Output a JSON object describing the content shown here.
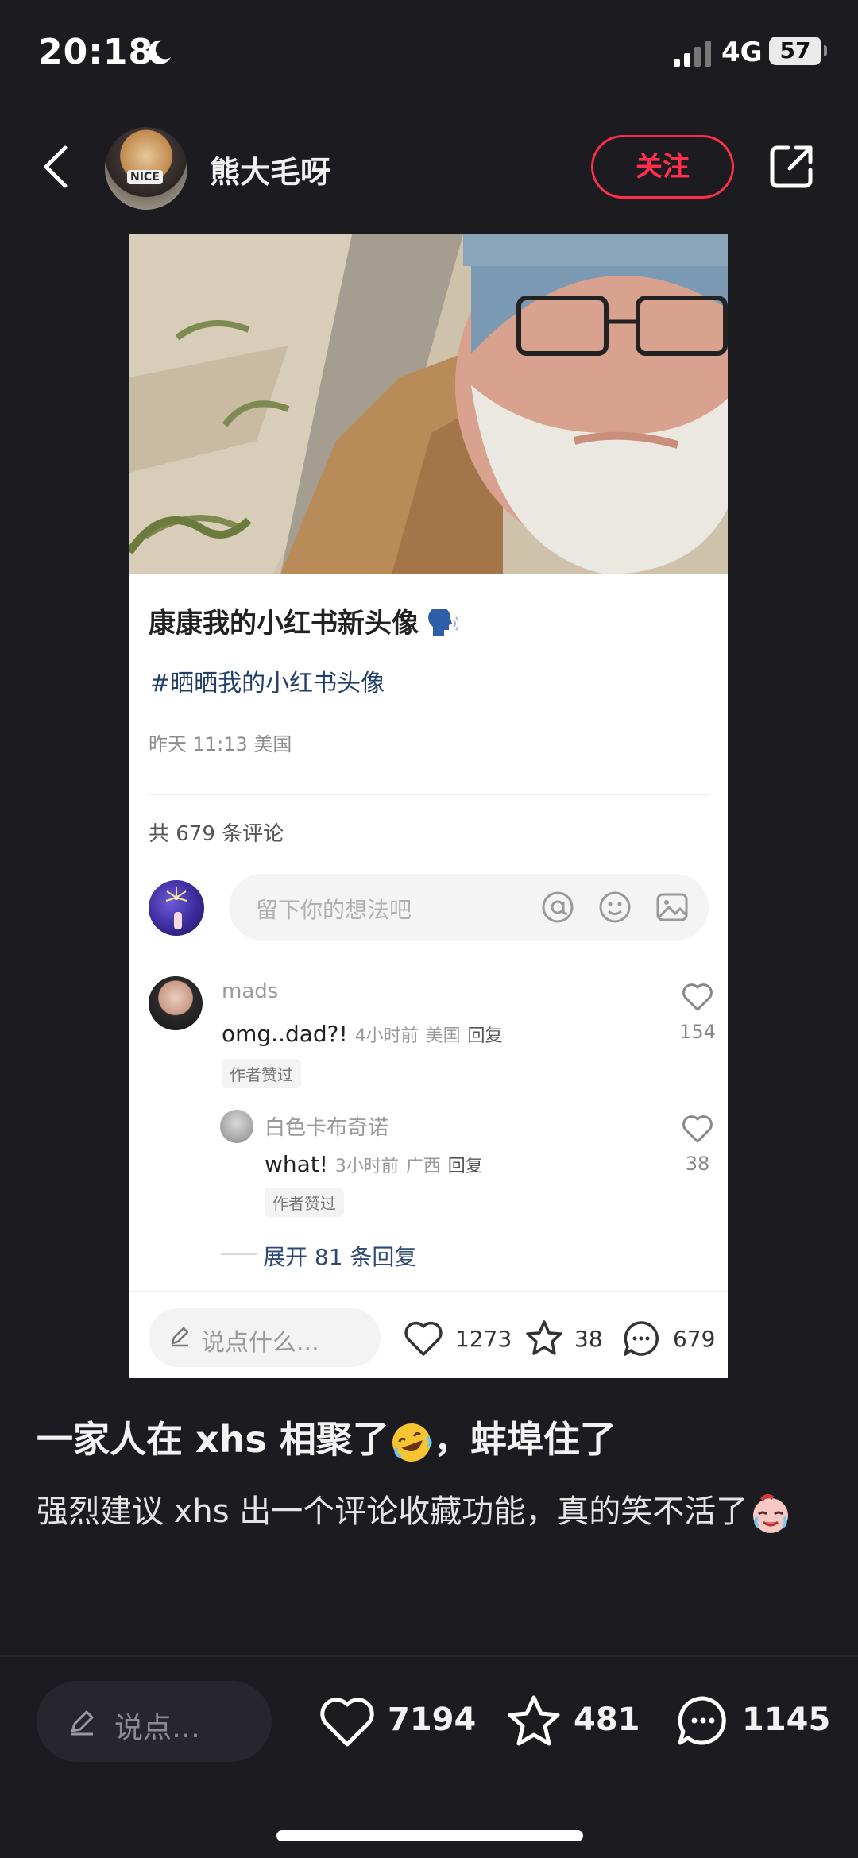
{
  "status": {
    "time": "20:18",
    "network": "4G",
    "battery": "57"
  },
  "header": {
    "username": "熊大毛呀",
    "follow_label": "关注",
    "avatar_text": "NICE"
  },
  "card": {
    "title": "康康我的小红书新头像",
    "tag": "#晒晒我的小红书头像",
    "meta": "昨天 11:13 美国",
    "comment_count": "共 679 条评论",
    "input_placeholder": "留下你的想法吧",
    "comments": [
      {
        "name": "mads",
        "text": "omg..dad?!",
        "time": "4小时前",
        "location": "美国",
        "reply": "回复",
        "badge": "作者赞过",
        "likes": "154"
      },
      {
        "name": "白色卡布奇诺",
        "text": "what!",
        "time": "3小时前",
        "location": "广西",
        "reply": "回复",
        "badge": "作者赞过",
        "likes": "38"
      }
    ],
    "expand_label": "展开 81 条回复",
    "bottom": {
      "placeholder": "说点什么...",
      "likes": "1273",
      "stars": "38",
      "comments": "679"
    }
  },
  "post": {
    "title": "一家人在 xhs 相聚了",
    "title_tail": "，蚌埠住了",
    "body": "强烈建议 xhs 出一个评论收藏功能，真的笑不活了"
  },
  "bottom_bar": {
    "placeholder": "说点…",
    "likes": "7194",
    "stars": "481",
    "comments": "1145"
  },
  "colors": {
    "accent": "#ff2e4d",
    "background": "#1b1b20",
    "tag": "#1f3f6a"
  }
}
